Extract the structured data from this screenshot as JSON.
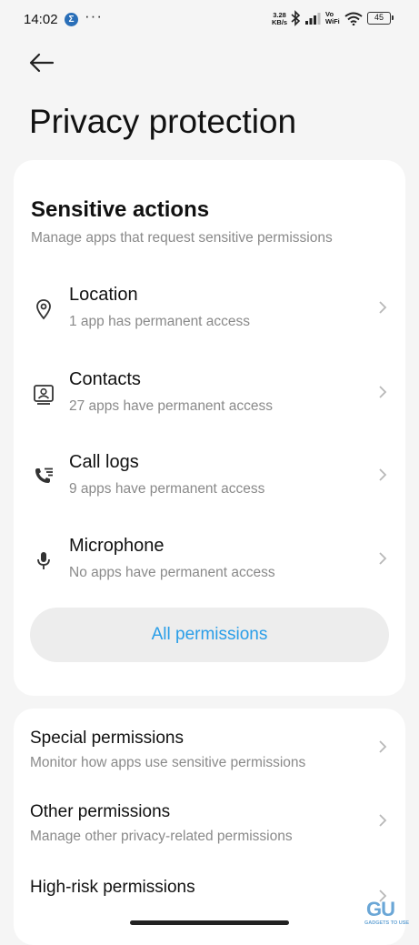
{
  "status_bar": {
    "time": "14:02",
    "notification_icon": "Σ",
    "more_dots": "···",
    "net_speed_value": "3.28",
    "net_speed_unit": "KB/s",
    "vowifi_top": "Vo",
    "vowifi_bottom": "WiFi",
    "battery": "45"
  },
  "header": {
    "back_icon": "arrow-left-icon",
    "title": "Privacy protection"
  },
  "sensitive_actions": {
    "title": "Sensitive actions",
    "subtitle": "Manage apps that request sensitive permissions",
    "items": [
      {
        "label": "Location",
        "sub": "1 app has permanent access",
        "icon": "location-pin-icon"
      },
      {
        "label": "Contacts",
        "sub": "27 apps have permanent access",
        "icon": "contacts-icon"
      },
      {
        "label": "Call logs",
        "sub": "9 apps have permanent access",
        "icon": "call-log-icon"
      },
      {
        "label": "Microphone",
        "sub": "No apps have permanent access",
        "icon": "microphone-icon"
      }
    ],
    "all_permissions_label": "All permissions"
  },
  "other_section": {
    "items": [
      {
        "label": "Special permissions",
        "sub": "Monitor how apps use sensitive permissions"
      },
      {
        "label": "Other permissions",
        "sub": "Manage other privacy-related permissions"
      },
      {
        "label": "High-risk permissions",
        "sub": ""
      }
    ]
  },
  "watermark": {
    "logo": "GU",
    "text": "GADGETS TO USE"
  },
  "colors": {
    "accent": "#2a9ee8",
    "background": "#f5f5f5",
    "card": "#ffffff",
    "secondary_text": "#8a8a8a"
  }
}
